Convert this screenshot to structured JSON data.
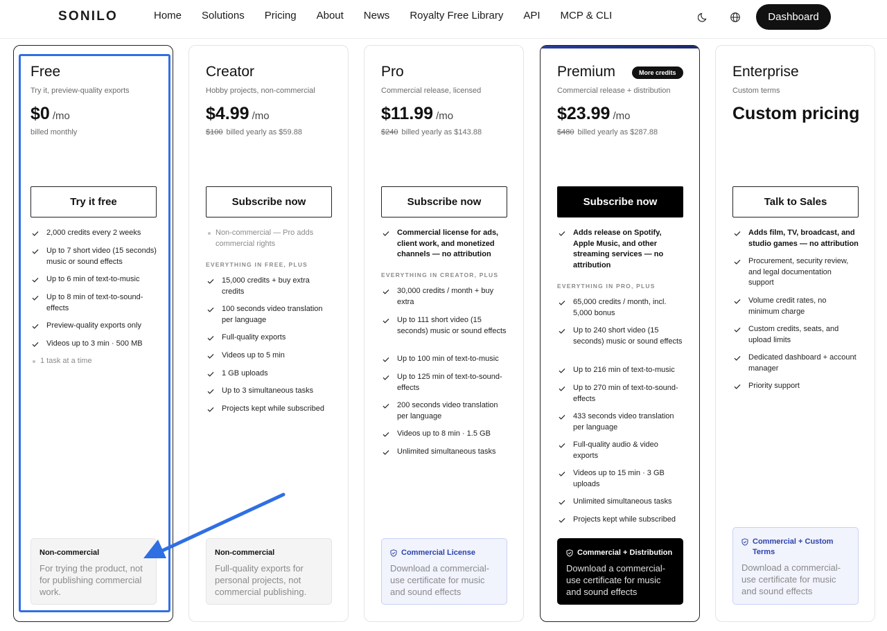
{
  "header": {
    "logo": "SONILO",
    "nav": [
      "Home",
      "Solutions",
      "Pricing",
      "About",
      "News",
      "Royalty Free Library",
      "API",
      "MCP & CLI"
    ],
    "dashboard": "Dashboard",
    "icons": [
      "moon-icon",
      "globe-icon"
    ]
  },
  "plans": [
    {
      "name": "Free",
      "subtitle": "Try it, preview-quality exports",
      "price": "$0",
      "per": "/mo",
      "billed": "billed monthly",
      "cta": "Try it free",
      "features": [
        "2,000 credits every 2 weeks",
        "Up to 7 short video (15 seconds) music or sound effects",
        "Up to 6 min of text-to-music",
        "Up to 8 min of text-to-sound-effects",
        "Preview-quality exports only",
        "Videos up to 3 min · 500 MB"
      ],
      "muted_feature": "1 task at a time",
      "license_title": "Non-commercial",
      "license_body": "For trying the product, not for publishing commercial work."
    },
    {
      "name": "Creator",
      "subtitle": "Hobby projects, non-commercial",
      "price": "$4.99",
      "per": "/mo",
      "strike": "$100",
      "billed": "billed yearly as $59.88",
      "cta": "Subscribe now",
      "muted_feature": "Non-commercial — Pro adds commercial rights",
      "section": "EVERYTHING IN FREE, PLUS",
      "features": [
        "15,000 credits + buy extra credits",
        "100 seconds video translation per language",
        "Full-quality exports",
        "Videos up to 5 min",
        "1 GB uploads",
        "Up to 3 simultaneous tasks",
        "Projects kept while subscribed"
      ],
      "license_title": "Non-commercial",
      "license_body": "Full-quality exports for personal projects, not commercial publishing."
    },
    {
      "name": "Pro",
      "subtitle": "Commercial release, licensed",
      "price": "$11.99",
      "per": "/mo",
      "strike": "$240",
      "billed": "billed yearly as $143.88",
      "cta": "Subscribe now",
      "highlight": "Commercial license for ads, client work, and monetized channels — no attribution",
      "section": "EVERYTHING IN CREATOR, PLUS",
      "features": [
        "30,000 credits / month + buy extra",
        "Up to 111 short video (15 seconds) music or sound effects",
        "Up to 100 min of text-to-music",
        "Up to 125 min of text-to-sound-effects",
        "200 seconds video translation per language",
        "Videos up to 8 min · 1.5 GB",
        "Unlimited simultaneous tasks"
      ],
      "license_title": "Commercial License",
      "license_body": "Download a commercial-use certificate for music and sound effects"
    },
    {
      "name": "Premium",
      "badge": "More credits",
      "subtitle": "Commercial release + distribution",
      "price": "$23.99",
      "per": "/mo",
      "strike": "$480",
      "billed": "billed yearly as $287.88",
      "cta": "Subscribe now",
      "highlight": "Adds release on Spotify, Apple Music, and other streaming services — no attribution",
      "section": "EVERYTHING IN PRO, PLUS",
      "features": [
        "65,000 credits / month, incl. 5,000 bonus",
        "Up to 240 short video (15 seconds) music or sound effects",
        "Up to 216 min of text-to-music",
        "Up to 270 min of text-to-sound-effects",
        "433 seconds video translation per language",
        "Full-quality audio & video exports",
        "Videos up to 15 min · 3 GB uploads",
        "Unlimited simultaneous tasks",
        "Projects kept while subscribed"
      ],
      "license_title": "Commercial + Distribution",
      "license_body": "Download a commercial-use certificate for music and sound effects"
    },
    {
      "name": "Enterprise",
      "subtitle": "Custom terms",
      "price": "Custom pricing",
      "cta": "Talk to Sales",
      "highlight": "Adds film, TV, broadcast, and studio games — no attribution",
      "features": [
        "Procurement, security review, and legal documentation support",
        "Volume credit rates, no minimum charge",
        "Custom credits, seats, and upload limits",
        "Dedicated dashboard + account manager",
        "Priority support"
      ],
      "license_title": "Commercial + Custom Terms",
      "license_body": "Download a commercial-use certificate for music and sound effects"
    }
  ],
  "colors": {
    "accent_blue": "#2f6fe4",
    "license_blue": "#2c43a8",
    "text": "#111111",
    "muted": "#8a8a8a"
  }
}
